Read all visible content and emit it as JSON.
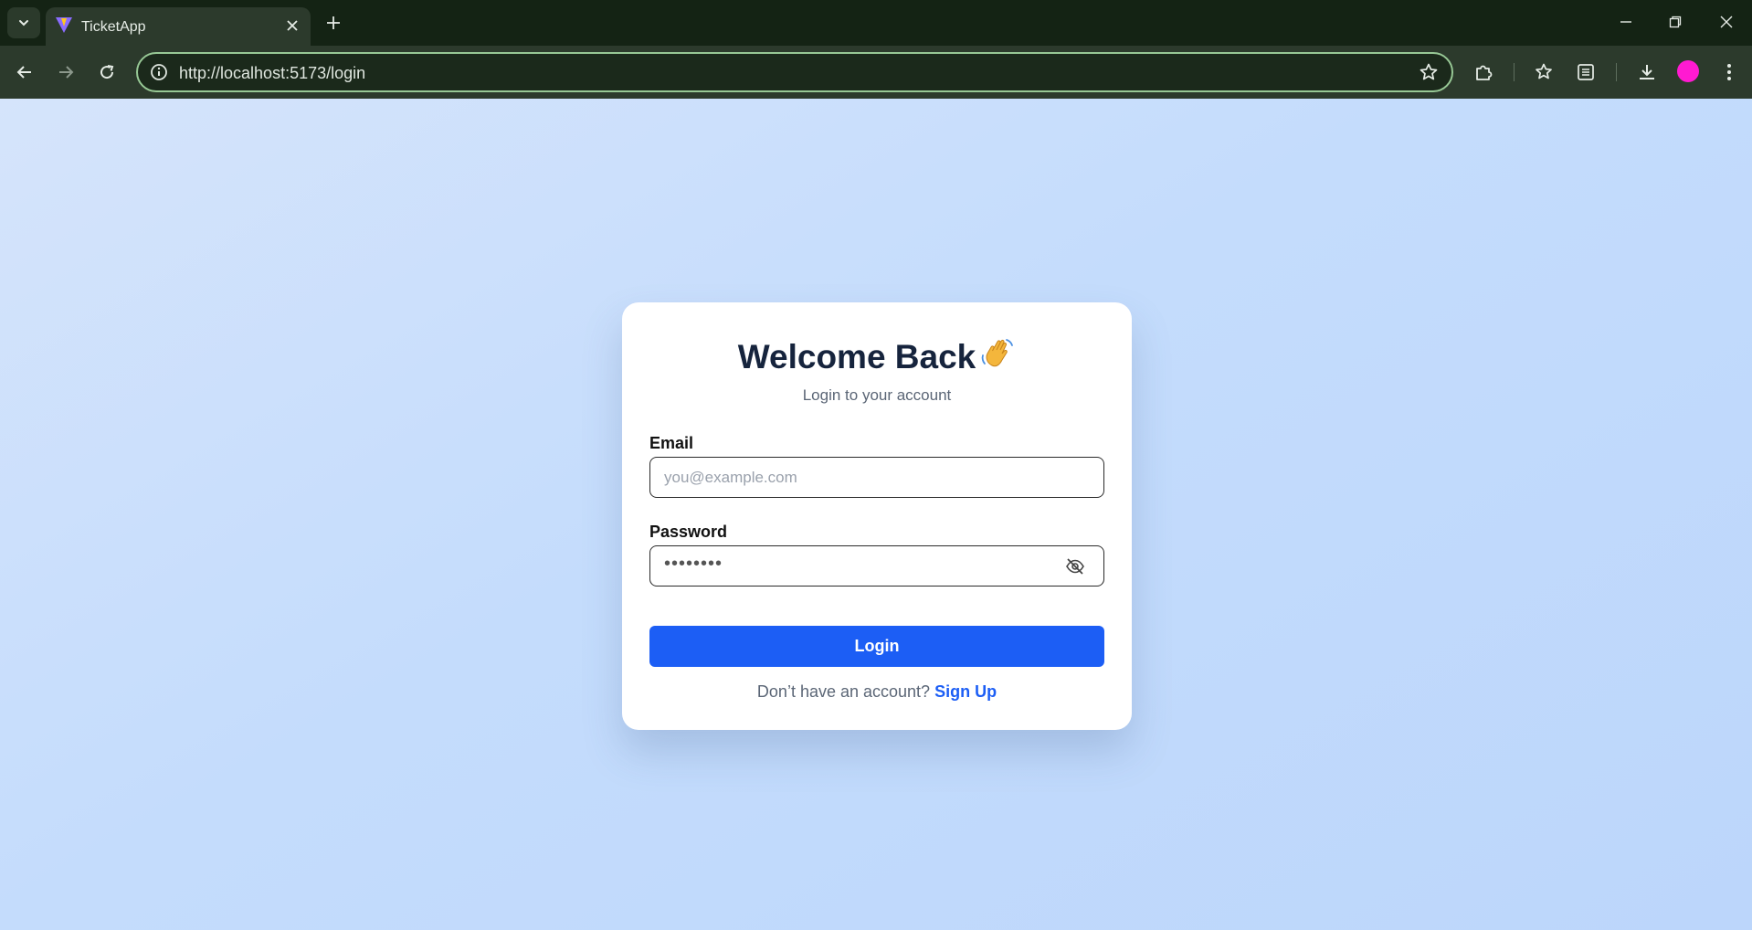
{
  "browser": {
    "tab_title": "TicketApp",
    "url": "http://localhost:5173/login"
  },
  "login": {
    "title": "Welcome Back",
    "title_emoji": "waving-hand",
    "subtitle": "Login to your account",
    "email_label": "Email",
    "email_placeholder": "you@example.com",
    "password_label": "Password",
    "password_masked": "••••••••",
    "button_label": "Login",
    "footer_prompt": "Don’t have an account?",
    "signup_link": "Sign Up"
  },
  "colors": {
    "accent": "#1c5ef5",
    "page_background": "#c9defb",
    "browser_frame": "#2c3a2c",
    "profile_avatar": "#ff1ad1"
  }
}
